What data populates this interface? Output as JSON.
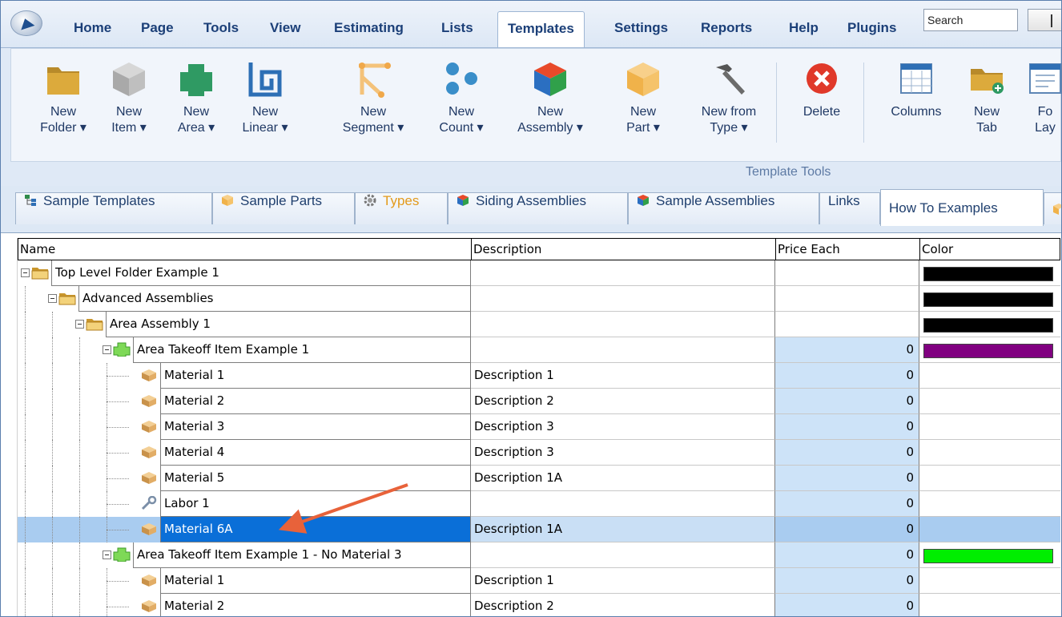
{
  "menu": {
    "items": [
      "Home",
      "Page",
      "Tools",
      "View",
      "Estimating",
      "Lists",
      "Templates",
      "Settings",
      "Reports",
      "Help",
      "Plugins"
    ],
    "active": "Templates",
    "search_placeholder": "Search"
  },
  "ribbon": {
    "buttons": [
      {
        "line1": "New",
        "line2": "Folder ▾",
        "icon": "folder-icon"
      },
      {
        "line1": "New",
        "line2": "Item ▾",
        "icon": "item-cube-icon"
      },
      {
        "line1": "New",
        "line2": "Area ▾",
        "icon": "area-shape-icon"
      },
      {
        "line1": "New",
        "line2": "Linear ▾",
        "icon": "linear-icon"
      },
      {
        "line1": "New",
        "line2": "Segment ▾",
        "icon": "segment-icon"
      },
      {
        "line1": "New",
        "line2": "Count ▾",
        "icon": "count-dots-icon"
      },
      {
        "line1": "New",
        "line2": "Assembly ▾",
        "icon": "assembly-cube-icon"
      },
      {
        "line1": "New",
        "line2": "Part ▾",
        "icon": "part-cube-icon"
      },
      {
        "line1": "New from",
        "line2": "Type ▾",
        "icon": "hammer-icon"
      },
      {
        "line1": "Delete",
        "line2": "",
        "icon": "delete-icon"
      },
      {
        "line1": "Columns",
        "line2": "",
        "icon": "columns-icon"
      },
      {
        "line1": "New",
        "line2": "Tab",
        "icon": "new-tab-icon"
      },
      {
        "line1": "Fo",
        "line2": "Lay",
        "icon": "form-layout-icon"
      }
    ],
    "group_label": "Template Tools"
  },
  "tabs": [
    {
      "label": "Sample Templates",
      "icon": "template-tree-icon"
    },
    {
      "label": "Sample Parts",
      "icon": "part-cube-icon"
    },
    {
      "label": "Types",
      "icon": "types-gear-icon"
    },
    {
      "label": "Siding Assemblies",
      "icon": "assembly-cube-icon"
    },
    {
      "label": "Sample Assemblies",
      "icon": "assembly-cube-icon"
    },
    {
      "label": "Links",
      "icon": ""
    },
    {
      "label": "How To Examples",
      "icon": ""
    }
  ],
  "active_tab": "How To Examples",
  "grid": {
    "headers": [
      "Name",
      "Description",
      "Price Each",
      "Color"
    ],
    "rows": [
      {
        "name": "Top Level Folder Example 1",
        "desc": "",
        "price": "",
        "color": "#000000",
        "icon": "folder",
        "level": 0,
        "expander": true,
        "selected": false
      },
      {
        "name": "Advanced Assemblies",
        "desc": "",
        "price": "",
        "color": "#000000",
        "icon": "folder",
        "level": 1,
        "expander": true,
        "selected": false
      },
      {
        "name": "Area Assembly 1",
        "desc": "",
        "price": "",
        "color": "#000000",
        "icon": "folder",
        "level": 2,
        "expander": true,
        "selected": false
      },
      {
        "name": "Area Takeoff Item Example 1",
        "desc": "",
        "price": "0",
        "color": "#800080",
        "icon": "area",
        "level": 3,
        "expander": true,
        "selected": false
      },
      {
        "name": "Material 1",
        "desc": "Description 1",
        "price": "0",
        "color": "",
        "icon": "material",
        "level": 4,
        "expander": false,
        "selected": false
      },
      {
        "name": "Material 2",
        "desc": "Description 2",
        "price": "0",
        "color": "",
        "icon": "material",
        "level": 4,
        "expander": false,
        "selected": false
      },
      {
        "name": "Material 3",
        "desc": "Description 3",
        "price": "0",
        "color": "",
        "icon": "material",
        "level": 4,
        "expander": false,
        "selected": false
      },
      {
        "name": "Material 4",
        "desc": "Description 3",
        "price": "0",
        "color": "",
        "icon": "material",
        "level": 4,
        "expander": false,
        "selected": false
      },
      {
        "name": "Material 5",
        "desc": "Description 1A",
        "price": "0",
        "color": "",
        "icon": "material",
        "level": 4,
        "expander": false,
        "selected": false
      },
      {
        "name": "Labor 1",
        "desc": "",
        "price": "0",
        "color": "",
        "icon": "labor",
        "level": 4,
        "expander": false,
        "selected": false
      },
      {
        "name": "Material 6A",
        "desc": "Description 1A",
        "price": "0",
        "color": "",
        "icon": "material",
        "level": 4,
        "expander": false,
        "selected": true
      },
      {
        "name": "Area Takeoff Item Example 1 - No Material 3",
        "desc": "",
        "price": "0",
        "color": "#00ee00",
        "icon": "area",
        "level": 3,
        "expander": true,
        "selected": false
      },
      {
        "name": "Material 1",
        "desc": "Description 1",
        "price": "0",
        "color": "",
        "icon": "material",
        "level": 4,
        "expander": false,
        "selected": false
      },
      {
        "name": "Material 2",
        "desc": "Description 2",
        "price": "0",
        "color": "",
        "icon": "material",
        "level": 4,
        "expander": false,
        "selected": false
      }
    ]
  },
  "annotation_color": "#e8623a"
}
